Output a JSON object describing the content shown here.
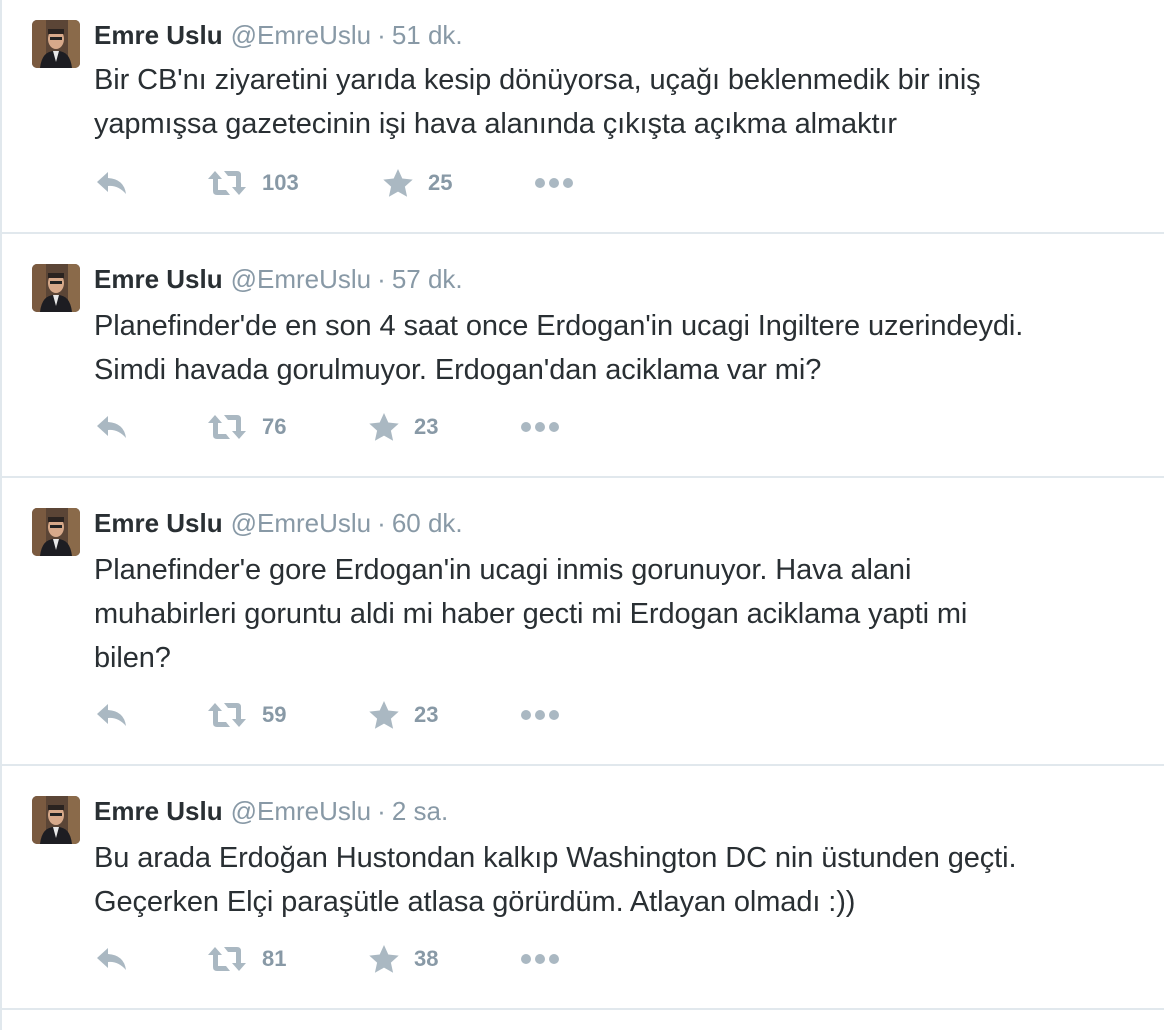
{
  "colors": {
    "text": "#292f33",
    "meta": "#8899a6",
    "icon": "#aab8c2",
    "divider": "#e1e8ed"
  },
  "icons": {
    "reply": "reply-icon",
    "retweet": "retweet-icon",
    "favorite": "star-icon",
    "more": "more-dots-icon"
  },
  "tweets": [
    {
      "fullname": "Emre Uslu",
      "username": "@EmreUslu",
      "separator": "·",
      "time": "51 dk.",
      "lines": [
        "Bir CB'nı ziyaretini yarıda kesip dönüyorsa, uçağı beklenmedik bir iniş",
        "yapmışsa gazetecinin işi hava alanında çıkışta açıkma almaktır"
      ],
      "retweets": "103",
      "favorites": "25"
    },
    {
      "fullname": "Emre Uslu",
      "username": "@EmreUslu",
      "separator": "·",
      "time": "57 dk.",
      "lines": [
        "Planefinder'de en son 4 saat once Erdogan'in ucagi Ingiltere uzerindeydi.",
        "Simdi havada gorulmuyor. Erdogan'dan aciklama var mi?"
      ],
      "retweets": "76",
      "favorites": "23"
    },
    {
      "fullname": "Emre Uslu",
      "username": "@EmreUslu",
      "separator": "·",
      "time": "60 dk.",
      "lines": [
        "Planefinder'e gore Erdogan'in ucagi inmis gorunuyor. Hava alani",
        "muhabirleri goruntu aldi mi haber gecti mi Erdogan aciklama yapti mi",
        "bilen?"
      ],
      "retweets": "59",
      "favorites": "23"
    },
    {
      "fullname": "Emre Uslu",
      "username": "@EmreUslu",
      "separator": "·",
      "time": "2 sa.",
      "lines": [
        "Bu arada Erdoğan Hustondan kalkıp Washington DC nin üstunden geçti.",
        "Geçerken Elçi paraşütle atlasa görürdüm. Atlayan olmadı :))"
      ],
      "retweets": "81",
      "favorites": "38"
    }
  ]
}
